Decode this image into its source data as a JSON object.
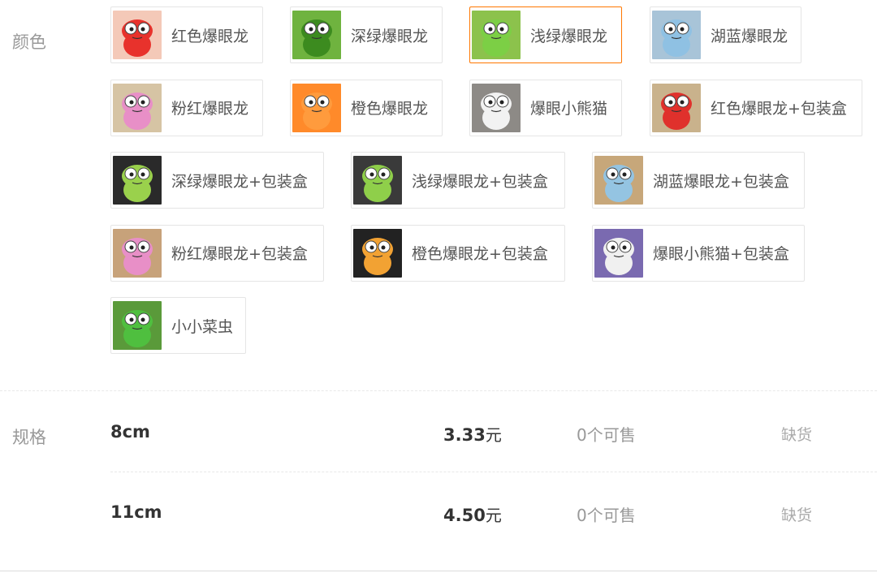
{
  "color": {
    "label": "颜色",
    "rows": [
      [
        {
          "label": "红色爆眼龙",
          "bg": "#f4c9b8",
          "body": "#e8322c",
          "selected": false
        },
        {
          "label": "深绿爆眼龙",
          "bg": "#6fb33f",
          "body": "#3c8b1f",
          "selected": false
        },
        {
          "label": "浅绿爆眼龙",
          "bg": "#8cc24c",
          "body": "#7ccf45",
          "selected": true
        },
        {
          "label": "湖蓝爆眼龙",
          "bg": "#a8c4d8",
          "body": "#8fc1e3",
          "selected": false
        }
      ],
      [
        {
          "label": "粉红爆眼龙",
          "bg": "#d6c4a4",
          "body": "#e88fc7",
          "selected": false
        },
        {
          "label": "橙色爆眼龙",
          "bg": "#ff8a2a",
          "body": "#ff9b3d",
          "selected": false
        },
        {
          "label": "爆眼小熊猫",
          "bg": "#8d8a86",
          "body": "#f2f2f2",
          "selected": false
        },
        {
          "label": "红色爆眼龙+包装盒",
          "bg": "#c9b28c",
          "body": "#e0312c",
          "selected": false
        }
      ],
      [
        {
          "label": "深绿爆眼龙+包装盒",
          "bg": "#2a2a2a",
          "body": "#9ad14c",
          "selected": false
        },
        {
          "label": "浅绿爆眼龙+包装盒",
          "bg": "#3a3a3a",
          "body": "#8fcf4a",
          "selected": false
        },
        {
          "label": "湖蓝爆眼龙+包装盒",
          "bg": "#c7a77a",
          "body": "#94c4e2",
          "selected": false
        }
      ],
      [
        {
          "label": "粉红爆眼龙+包装盒",
          "bg": "#c7a27a",
          "body": "#e88fc7",
          "selected": false
        },
        {
          "label": "橙色爆眼龙+包装盒",
          "bg": "#222222",
          "body": "#f2a233",
          "selected": false
        },
        {
          "label": "爆眼小熊猫+包装盒",
          "bg": "#7a6ab0",
          "body": "#f0f0f0",
          "selected": false
        }
      ],
      [
        {
          "label": "小小菜虫",
          "bg": "#5a9a3a",
          "body": "#4fbf3f",
          "selected": false
        }
      ]
    ]
  },
  "spec": {
    "label": "规格",
    "items": [
      {
        "name": "8cm",
        "price": "3.33",
        "unit": "元",
        "stock": "0个可售",
        "status": "缺货"
      },
      {
        "name": "11cm",
        "price": "4.50",
        "unit": "元",
        "stock": "0个可售",
        "status": "缺货"
      }
    ]
  }
}
